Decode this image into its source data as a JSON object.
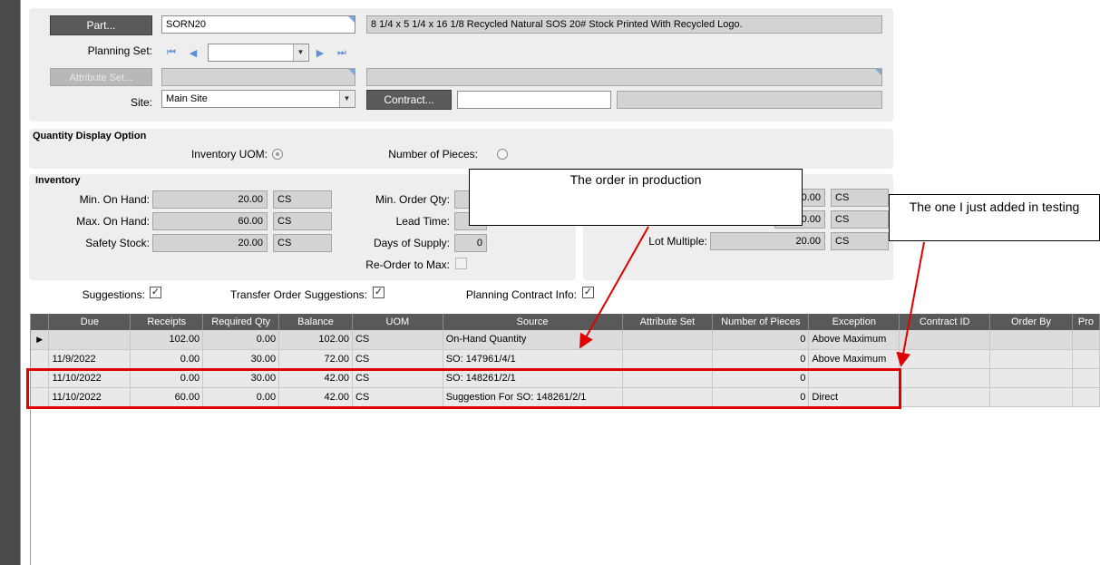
{
  "header": {
    "part_button": "Part...",
    "part_value": "SORN20",
    "part_description": "8 1/4 x 5 1/4 x 16 1/8 Recycled Natural SOS 20# Stock Printed With Recycled Logo.",
    "planning_set_label": "Planning Set:",
    "planning_set_value": "",
    "attribute_set_button": "Attribute Set...",
    "site_label": "Site:",
    "site_value": "Main Site",
    "contract_button": "Contract...",
    "contract_value": ""
  },
  "quantity_display": {
    "title": "Quantity Display Option",
    "inventory_uom_label": "Inventory UOM:",
    "number_of_pieces_label": "Number of Pieces:"
  },
  "inventory": {
    "title": "Inventory",
    "min_on_hand_label": "Min. On Hand:",
    "min_on_hand_value": "20.00",
    "min_on_hand_uom": "CS",
    "max_on_hand_label": "Max. On Hand:",
    "max_on_hand_value": "60.00",
    "max_on_hand_uom": "CS",
    "safety_stock_label": "Safety Stock:",
    "safety_stock_value": "20.00",
    "safety_stock_uom": "CS",
    "min_order_qty_label": "Min. Order Qty:",
    "lead_time_label": "Lead Time:",
    "days_of_supply_label": "Days of Supply:",
    "days_of_supply_value": "0",
    "reorder_to_max_label": "Re-Order to Max:",
    "right_field1_value": "0.00",
    "right_field1_uom": "CS",
    "right_field2_value": "0.00",
    "right_field2_uom": "CS",
    "lot_multiple_label": "Lot Multiple:",
    "lot_multiple_value": "20.00",
    "lot_multiple_uom": "CS"
  },
  "options": {
    "suggestions_label": "Suggestions:",
    "transfer_order_suggestions_label": "Transfer Order Suggestions:",
    "planning_contract_info_label": "Planning Contract Info:"
  },
  "grid": {
    "columns": [
      "Due",
      "Receipts",
      "Required Qty",
      "Balance",
      "UOM",
      "Source",
      "Attribute Set",
      "Number of Pieces",
      "Exception",
      "Contract ID",
      "Order By",
      "Pro"
    ],
    "rows": [
      [
        "",
        "102.00",
        "0.00",
        "102.00",
        "CS",
        "On-Hand Quantity",
        "",
        "0",
        "Above Maximum",
        "",
        "",
        ""
      ],
      [
        "11/9/2022",
        "0.00",
        "30.00",
        "72.00",
        "CS",
        "SO: 147961/4/1",
        "",
        "0",
        "Above Maximum",
        "",
        "",
        ""
      ],
      [
        "11/10/2022",
        "0.00",
        "30.00",
        "42.00",
        "CS",
        "SO: 148261/2/1",
        "",
        "0",
        "",
        "",
        "",
        ""
      ],
      [
        "11/10/2022",
        "60.00",
        "0.00",
        "42.00",
        "CS",
        "Suggestion For SO: 148261/2/1",
        "",
        "0",
        "Direct",
        "",
        "",
        ""
      ]
    ]
  },
  "annotations": {
    "callout1": "The order in production",
    "callout2": "The one I just added in testing",
    "arrow_color": "#e00000",
    "highlight_color": "#e00000"
  }
}
